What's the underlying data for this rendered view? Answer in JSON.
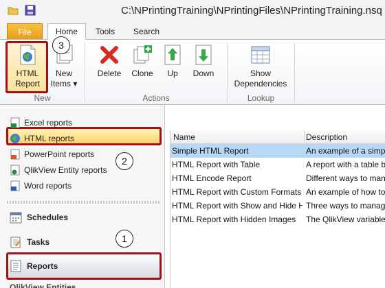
{
  "title_bar": {
    "path": "C:\\NPrintingTraining\\NPrintingFiles\\NPrintingTraining.nsq",
    "quick_access": [
      {
        "icon": "folder-icon"
      },
      {
        "icon": "save-icon"
      }
    ]
  },
  "tabs": [
    {
      "label": "File",
      "active": false
    },
    {
      "label": "Home",
      "active": true
    },
    {
      "label": "Tools",
      "active": false
    },
    {
      "label": "Search",
      "active": false
    }
  ],
  "ribbon": {
    "groups": [
      {
        "label": "New",
        "buttons": [
          {
            "label": "HTML\nReport",
            "icon": "html-report-icon",
            "highlighted": true
          },
          {
            "label": "New\nItems ▾",
            "icon": "new-items-icon"
          }
        ]
      },
      {
        "label": "Actions",
        "buttons": [
          {
            "label": "Delete",
            "icon": "delete-icon"
          },
          {
            "label": "Clone",
            "icon": "clone-icon"
          },
          {
            "label": "Up",
            "icon": "up-arrow-icon"
          },
          {
            "label": "Down",
            "icon": "down-arrow-icon"
          }
        ]
      },
      {
        "label": "Lookup",
        "buttons": [
          {
            "label": "Show\nDependencies",
            "icon": "show-dependencies-icon"
          }
        ]
      }
    ]
  },
  "callouts": {
    "one": "1",
    "two": "2",
    "three": "3"
  },
  "navigator": {
    "report_types": [
      {
        "label": "Excel reports",
        "icon": "excel-icon"
      },
      {
        "label": "HTML reports",
        "icon": "html-globe-icon",
        "selected": true
      },
      {
        "label": "PowerPoint reports",
        "icon": "powerpoint-icon"
      },
      {
        "label": "QlikView Entity reports",
        "icon": "qlikview-entity-icon"
      },
      {
        "label": "Word reports",
        "icon": "word-icon"
      }
    ],
    "sections": [
      {
        "label": "Schedules",
        "icon": "schedules-icon"
      },
      {
        "label": "Tasks",
        "icon": "tasks-icon"
      },
      {
        "label": "Reports",
        "icon": "reports-icon",
        "selected": true
      }
    ],
    "cut_off_label": "QlikView Entities"
  },
  "grid": {
    "columns": [
      "Name",
      "Description"
    ],
    "rows": [
      {
        "name": "Simple HTML Report",
        "description": "An example of a simpl",
        "selected": true
      },
      {
        "name": "HTML Report with Table",
        "description": "A report with a table b"
      },
      {
        "name": "HTML Encode Report",
        "description": "Different ways to man"
      },
      {
        "name": "HTML Report with Custom Formats",
        "description": "An example of how to"
      },
      {
        "name": "HTML Report with Show and Hide H",
        "description": "Three ways to manage"
      },
      {
        "name": "HTML Report with Hidden Images",
        "description": "The QlikView variable"
      }
    ]
  },
  "colors": {
    "highlight_red": "#a1101b",
    "selection_gold": "#fcd56c",
    "row_selected": "#b9d8f6",
    "file_tab": "#e79a14"
  }
}
